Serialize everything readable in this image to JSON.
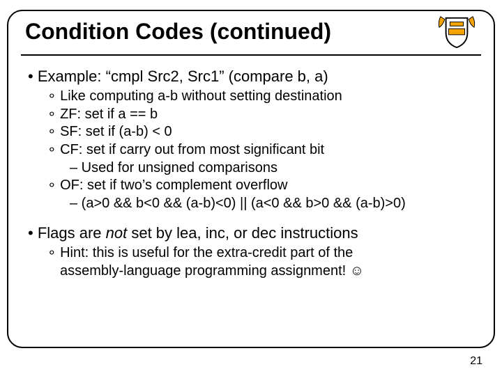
{
  "title": "Condition Codes (continued)",
  "bullets": {
    "b1": "• Example: “cmpl Src2, Src1” (compare b, a)",
    "s1": "∘ Like computing a-b without setting destination",
    "s2": "∘ ZF: set if a == b",
    "s3": "∘ SF: set if (a-b) < 0",
    "s4": "∘ CF: set if carry out from most significant bit",
    "d1": "– Used for unsigned comparisons",
    "s5": "∘ OF: set if two’s complement overflow",
    "d2": "– (a>0 && b<0 && (a-b)<0) || (a<0 && b>0 && (a-b)>0)",
    "b2_pre": "• Flags are ",
    "b2_it": "not",
    "b2_post": " set by lea, inc, or dec instructions",
    "s6a": "∘ Hint: this is useful for the extra-credit part of the",
    "s6b": "assembly-language programming assignment! ☺"
  },
  "page_number": "21"
}
